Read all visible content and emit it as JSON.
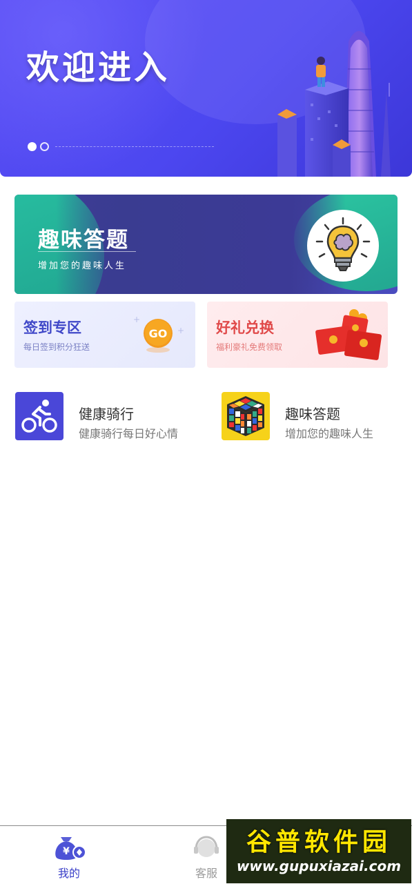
{
  "banner": {
    "title": "欢迎进入",
    "page_indicator": {
      "count": 2,
      "active": 1
    }
  },
  "quiz_banner": {
    "title": "趣味答题",
    "subtitle": "增加您的趣味人生"
  },
  "cards": [
    {
      "title": "签到专区",
      "subtitle": "每日签到积分狂送",
      "badge": "GO"
    },
    {
      "title": "好礼兑换",
      "subtitle": "福利豪礼免费领取"
    }
  ],
  "list_items": [
    {
      "title": "健康骑行",
      "subtitle": "健康骑行每日好心情",
      "icon": "cycling-icon"
    },
    {
      "title": "趣味答题",
      "subtitle": "增加您的趣味人生",
      "icon": "rubiks-cube-icon"
    }
  ],
  "tabbar": {
    "tabs": [
      {
        "label": "我的",
        "icon": "money-bag-icon",
        "active": true
      },
      {
        "label": "客服",
        "icon": "customer-service-icon",
        "active": false
      }
    ]
  },
  "watermark": {
    "title": "谷普软件园",
    "url": "www.gupuxiazai.com"
  },
  "colors": {
    "banner_primary": "#4c47f0",
    "accent": "#3a3fc8",
    "teal": "#27c7a2",
    "gift_red": "#e04a4a"
  }
}
